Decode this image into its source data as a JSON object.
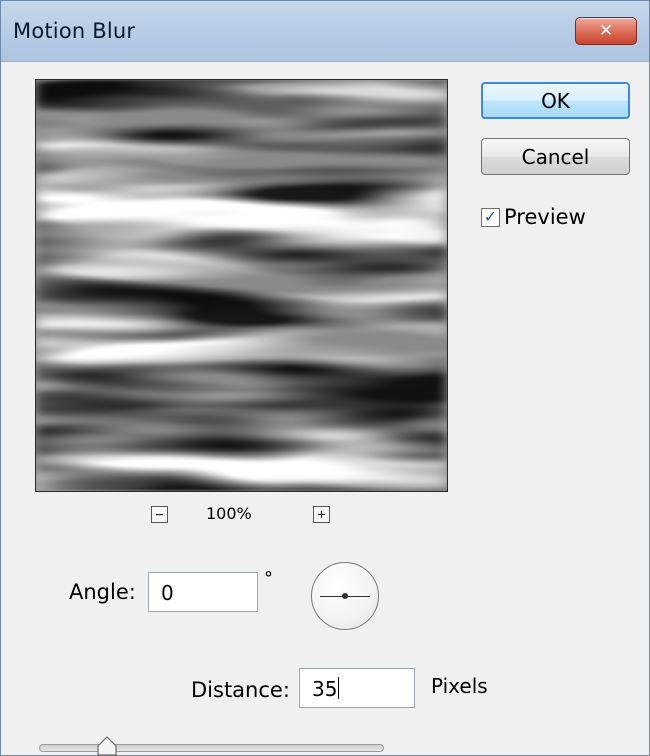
{
  "window": {
    "title": "Motion Blur",
    "close_glyph": "✕"
  },
  "buttons": {
    "ok_label": "OK",
    "cancel_label": "Cancel"
  },
  "preview": {
    "label": "Preview",
    "checked": true,
    "check_glyph": "✓"
  },
  "zoom": {
    "level": "100%",
    "minus_glyph": "−",
    "plus_glyph": "+"
  },
  "angle": {
    "label": "Angle:",
    "value": "0",
    "unit": "°"
  },
  "distance": {
    "label": "Distance:",
    "value": "35",
    "unit": "Pixels"
  },
  "slider": {
    "value": 35
  },
  "icons": {
    "close": "close-icon",
    "check": "checkmark-icon",
    "zoom_out": "zoom-out-icon",
    "zoom_in": "zoom-in-icon",
    "dial": "angle-dial-icon",
    "slider_thumb": "slider-thumb-icon"
  },
  "colors": {
    "title_bar": "#b6cbe5",
    "close_button": "#d96b55",
    "default_button_border": "#3c8ad1",
    "dialog_background": "#f0f0f0"
  }
}
